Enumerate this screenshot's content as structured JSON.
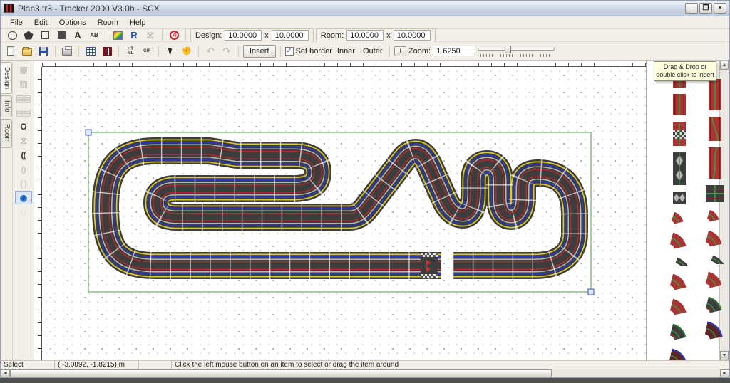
{
  "window": {
    "title": "Plan3.tr3 - Tracker 2000 V3.0b - SCX",
    "min": "_",
    "max": "❐",
    "close": "×"
  },
  "menu": {
    "items": [
      "File",
      "Edit",
      "Options",
      "Room",
      "Help"
    ]
  },
  "toolbar1": {
    "text_tool": "A",
    "ab_tool": "AB",
    "crossed": "⊠",
    "design": {
      "label": "Design:",
      "w": "10.0000",
      "x": "x",
      "h": "10.0000"
    },
    "room": {
      "label": "Room:",
      "w": "10.0000",
      "x": "x",
      "h": "10.0000"
    }
  },
  "toolbar2": {
    "html_icon_text": "HT ML",
    "gif_icon_text": "GIF",
    "undo": "↶",
    "redo": "↷",
    "insert": "Insert",
    "set_border": "Set border",
    "check": "✓",
    "inner": "Inner",
    "outer": "Outer",
    "plus": "+",
    "zoom_label": "Zoom:",
    "zoom_value": "1.6250"
  },
  "side_tabs": {
    "items": [
      "Design",
      "Info",
      "Room"
    ],
    "active": "Design"
  },
  "tool_column": {
    "tools": [
      {
        "name": "junction-tool",
        "glyph": "▩",
        "state": "disabled"
      },
      {
        "name": "straight-tool",
        "glyph": "▥",
        "state": "disabled"
      },
      {
        "name": "pieces-grid-tool",
        "glyph": "▤▤",
        "state": "disabled"
      },
      {
        "name": "pieces-grid2-tool",
        "glyph": "▤▤",
        "state": "disabled"
      },
      {
        "name": "oval-tool",
        "glyph": "O",
        "state": "normal"
      },
      {
        "name": "crossing-tool",
        "glyph": "⊠",
        "state": "disabled"
      },
      {
        "name": "curves-tool",
        "glyph": "((",
        "state": "normal"
      },
      {
        "name": "curve-pair-tool",
        "glyph": "()",
        "state": "disabled"
      },
      {
        "name": "loop-tool",
        "glyph": "( )",
        "state": "disabled"
      },
      {
        "name": "radius-tool",
        "glyph": "◉",
        "state": "active"
      },
      {
        "name": "circle-tool",
        "glyph": "◌",
        "state": "disabled"
      }
    ]
  },
  "track": {
    "surface": "#3d3d3d",
    "slot_colors": [
      "#d9c832",
      "#2a38b8",
      "#b9b9b9",
      "#b42a2a"
    ],
    "section_line": "#f2f2f2",
    "selection_color": "#4a9e4a",
    "handle_color": "#3355cc"
  },
  "pieces_panel": {
    "tooltip1": "Drag & Drop or",
    "tooltip2": "double click to insert",
    "body_color": "#a83434",
    "dark_color": "#3d3d3d",
    "line_color": "#3f9b3f",
    "columns": [
      {
        "items": [
          {
            "type": "straight-quarter",
            "name": "quarter-straight"
          },
          {
            "type": "straight-half",
            "name": "half-straight"
          },
          {
            "type": "straight-start",
            "name": "start-finish-straight"
          },
          {
            "type": "narrow",
            "name": "narrow-chicane"
          },
          {
            "type": "diamonds",
            "name": "connector-piece"
          },
          {
            "type": "curve-r-s",
            "name": "small-curve"
          },
          {
            "type": "curve-r-m",
            "name": "standard-curve"
          },
          {
            "type": "curve-d-s",
            "name": "short-dark-curve"
          },
          {
            "type": "curve-r-m",
            "name": "standard-curve"
          },
          {
            "type": "curve-r-m",
            "name": "standard-curve"
          },
          {
            "type": "curve-g",
            "name": "outer-curve"
          },
          {
            "type": "curve-b",
            "name": "banked-curve"
          }
        ]
      },
      {
        "items": [
          {
            "type": "straight-long",
            "name": "full-straight"
          },
          {
            "type": "straight-change",
            "name": "lane-change-straight"
          },
          {
            "type": "curve-cross",
            "name": "curve-crossover"
          },
          {
            "type": "cross",
            "name": "crossing-intersection"
          },
          {
            "type": "curve-r-s",
            "name": "small-curve"
          },
          {
            "type": "curve-r-m",
            "name": "standard-curve"
          },
          {
            "type": "curve-d-s",
            "name": "short-dark-curve"
          },
          {
            "type": "curve-r-m",
            "name": "standard-curve"
          },
          {
            "type": "curve-g",
            "name": "outer-curve"
          },
          {
            "type": "curve-b",
            "name": "banked-curve"
          }
        ]
      }
    ]
  },
  "status": {
    "mode": "Select",
    "coords": "( -3.0892, -1.8215) m",
    "message": "Click the left mouse button on an item to select or drag the item around"
  }
}
